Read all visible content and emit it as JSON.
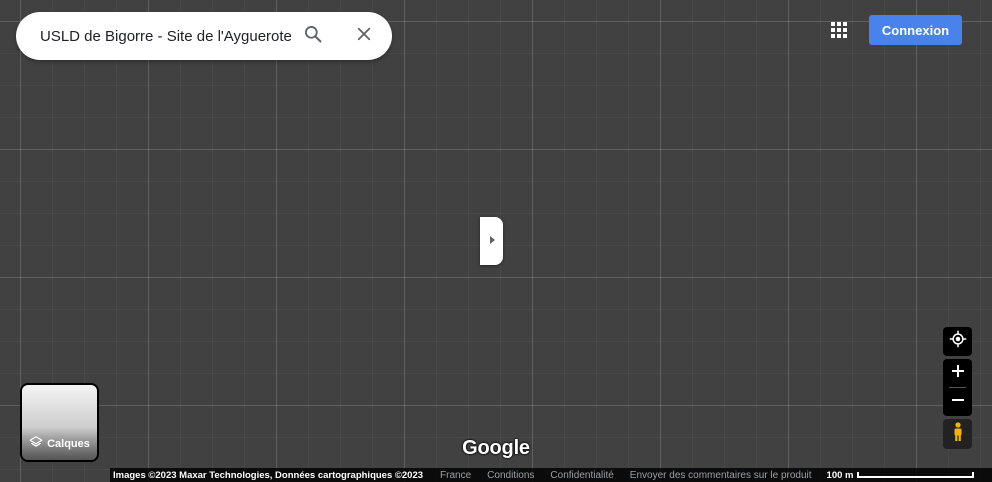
{
  "search": {
    "query": "USLD de Bigorre - Site de l'Ayguerote",
    "search_icon": "search-icon",
    "clear_icon": "close-icon"
  },
  "header": {
    "apps_icon": "apps-grid-icon",
    "signin_label": "Connexion"
  },
  "side_panel": {
    "toggle_icon": "chevron-right-icon"
  },
  "layers": {
    "label": "Calques",
    "icon": "layers-icon"
  },
  "controls": {
    "locate_icon": "my-location-icon",
    "zoom_in_icon": "plus-icon",
    "zoom_out_icon": "minus-icon",
    "street_view_icon": "pegman-icon"
  },
  "logo": "Google",
  "footer": {
    "attribution": "Images ©2023 Maxar Technologies, Données cartographiques ©2023",
    "country": "France",
    "terms": "Conditions",
    "privacy": "Confidentialité",
    "feedback": "Envoyer des commentaires sur le produit",
    "scale_label": "100 m"
  },
  "colors": {
    "map_background": "#414141",
    "signin_button": "#4a82ec",
    "pegman": "#f5b400"
  }
}
